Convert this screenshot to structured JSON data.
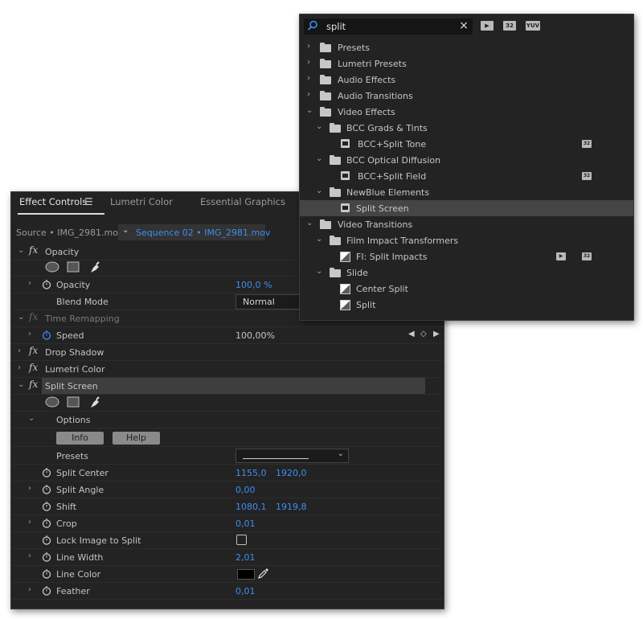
{
  "effect_controls": {
    "tabs": [
      "Effect Controls",
      "Lumetri Color",
      "Essential Graphics"
    ],
    "menu_icon": "hamburger-menu-icon",
    "source_label": "Source • IMG_2981.mov",
    "sequence_label": "Sequence 02 • IMG_2981.mov",
    "opacity": {
      "label": "Opacity",
      "param_label": "Opacity",
      "param_value": "100,0 %",
      "blend_label": "Blend Mode",
      "blend_value": "Normal"
    },
    "time_remapping": {
      "label": "Time Remapping",
      "speed_label": "Speed",
      "speed_value": "100,00%"
    },
    "drop_shadow": "Drop Shadow",
    "lumetri_color": "Lumetri Color",
    "split_screen": {
      "label": "Split Screen",
      "options_label": "Options",
      "info_button": "Info",
      "help_button": "Help",
      "presets_label": "Presets",
      "params": [
        {
          "label": "Split Center",
          "v1": "1155,0",
          "v2": "1920,0"
        },
        {
          "label": "Split Angle",
          "v1": "0,00"
        },
        {
          "label": "Shift",
          "v1": "1080,1",
          "v2": "1919,8"
        },
        {
          "label": "Crop",
          "v1": "0,01"
        },
        {
          "label": "Lock Image to Split"
        },
        {
          "label": "Line Width",
          "v1": "2,01"
        },
        {
          "label": "Line Color",
          "color": "#000000"
        },
        {
          "label": "Feather",
          "v1": "0,01"
        }
      ]
    },
    "accent_color": "#3d8ef0"
  },
  "effects_panel": {
    "search_value": "split",
    "filter_buttons": [
      "accelerated-effects-icon",
      "32-bit-icon",
      "yuv-icon"
    ],
    "filter_labels": [
      "▶",
      "32",
      "YUV"
    ],
    "tree": [
      {
        "label": "Presets"
      },
      {
        "label": "Lumetri Presets"
      },
      {
        "label": "Audio Effects"
      },
      {
        "label": "Audio Transitions"
      },
      {
        "label": "Video Effects"
      },
      {
        "label": "BCC Grads & Tints"
      },
      {
        "label": "BCC+Split Tone"
      },
      {
        "label": "BCC Optical Diffusion"
      },
      {
        "label": "BCC+Split Field"
      },
      {
        "label": "NewBlue Elements"
      },
      {
        "label": "Split Screen"
      },
      {
        "label": "Video Transitions"
      },
      {
        "label": "Film Impact Transformers"
      },
      {
        "label": "FI: Split Impacts"
      },
      {
        "label": "Slide"
      },
      {
        "label": "Center Split"
      },
      {
        "label": "Split"
      }
    ]
  }
}
